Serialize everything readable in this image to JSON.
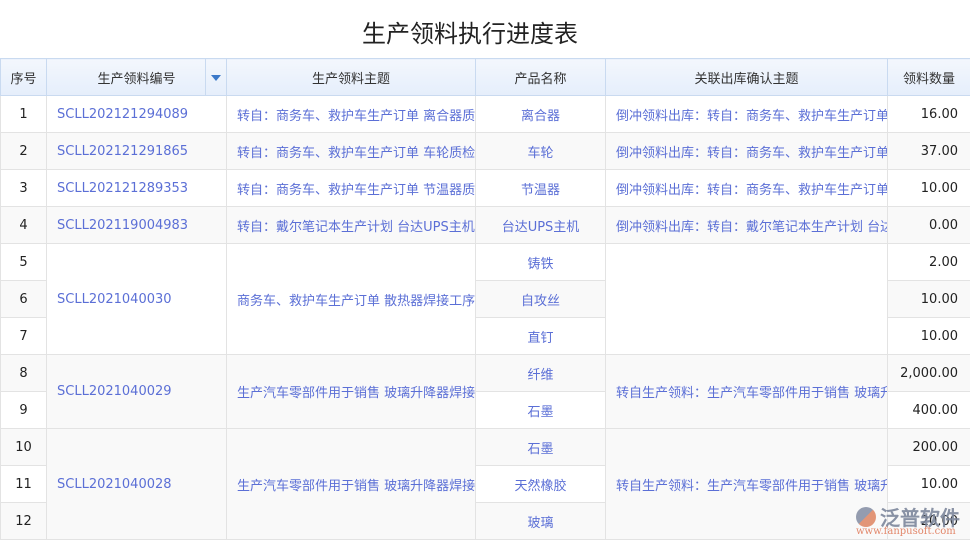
{
  "title": "生产领料执行进度表",
  "headers": [
    "序号",
    "生产领料编号",
    "生产领料主题",
    "产品名称",
    "关联出库确认主题",
    "领料数量"
  ],
  "rows": [
    {
      "no": "1",
      "code": "SCLL202121294089",
      "subject": "转自：商务车、救护车生产订单 离合器质",
      "product": "离合器",
      "related": "倒冲领料出库：转自：商务车、救护车生产订单",
      "qty": "16.00"
    },
    {
      "no": "2",
      "code": "SCLL202121291865",
      "subject": "转自：商务车、救护车生产订单 车轮质检",
      "product": "车轮",
      "related": "倒冲领料出库：转自：商务车、救护车生产订单",
      "qty": "37.00"
    },
    {
      "no": "3",
      "code": "SCLL202121289353",
      "subject": "转自：商务车、救护车生产订单 节温器质",
      "product": "节温器",
      "related": "倒冲领料出库：转自：商务车、救护车生产订单",
      "qty": "10.00"
    },
    {
      "no": "4",
      "code": "SCLL202119004983",
      "subject": "转自：戴尔笔记本生产计划 台达UPS主机",
      "product": "台达UPS主机",
      "related": "倒冲领料出库：转自：戴尔笔记本生产计划 台达",
      "qty": "0.00"
    }
  ],
  "groups": [
    {
      "code": "SCLL2021040030",
      "subject": "商务车、救护车生产订单 散热器焊接工序",
      "related": "",
      "items": [
        {
          "no": "5",
          "product": "铸铁",
          "qty": "2.00"
        },
        {
          "no": "6",
          "product": "自攻丝",
          "qty": "10.00"
        },
        {
          "no": "7",
          "product": "直钉",
          "qty": "10.00"
        }
      ]
    },
    {
      "code": "SCLL2021040029",
      "subject": "生产汽车零部件用于销售 玻璃升降器焊接",
      "related": "转自生产领料：生产汽车零部件用于销售 玻璃升",
      "items": [
        {
          "no": "8",
          "product": "纤维",
          "qty": "2,000.00"
        },
        {
          "no": "9",
          "product": "石墨",
          "qty": "400.00"
        }
      ]
    },
    {
      "code": "SCLL2021040028",
      "subject": "生产汽车零部件用于销售 玻璃升降器焊接",
      "related": "转自生产领料：生产汽车零部件用于销售 玻璃升",
      "items": [
        {
          "no": "10",
          "product": "石墨",
          "qty": "200.00"
        },
        {
          "no": "11",
          "product": "天然橡胶",
          "qty": "10.00"
        },
        {
          "no": "12",
          "product": "玻璃",
          "qty": "20.00"
        }
      ]
    }
  ],
  "watermark": {
    "name": "泛普软件",
    "url": "www.fanpusoft.com"
  }
}
